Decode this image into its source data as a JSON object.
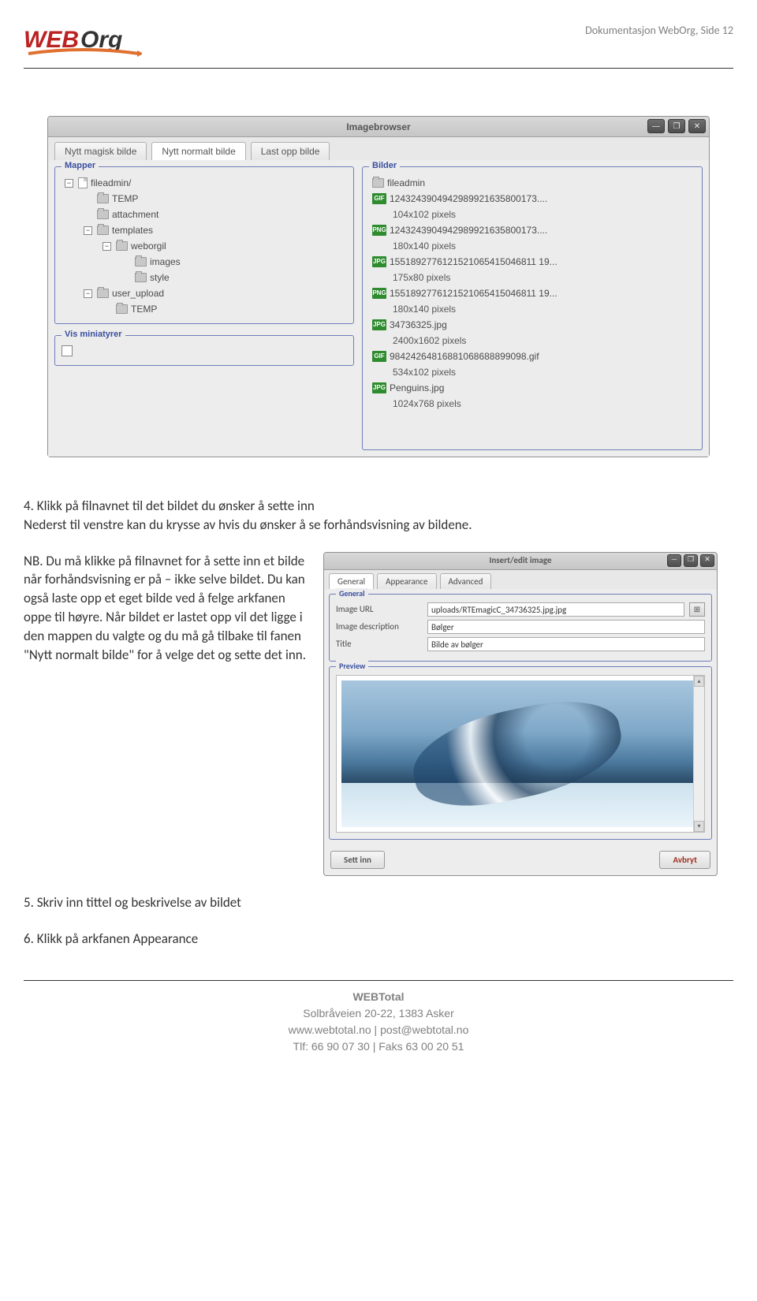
{
  "header": {
    "docline": "Dokumentasjon WebOrg, Side 12",
    "logo_text_a": "WEB",
    "logo_text_b": "Org"
  },
  "imagebrowser": {
    "title": "Imagebrowser",
    "tabs": [
      "Nytt magisk bilde",
      "Nytt normalt bilde",
      "Last opp bilde"
    ],
    "active_tab": 1,
    "folders_legend": "Mapper",
    "thumbs_legend": "Vis miniatyrer",
    "files_legend": "Bilder",
    "tree": [
      {
        "indent": 0,
        "pm": "−",
        "label": "fileadmin/",
        "icon": "file"
      },
      {
        "indent": 1,
        "pm": "",
        "label": "TEMP",
        "icon": "folder"
      },
      {
        "indent": 1,
        "pm": "",
        "label": "attachment",
        "icon": "folder"
      },
      {
        "indent": 1,
        "pm": "−",
        "label": "templates",
        "icon": "folder"
      },
      {
        "indent": 2,
        "pm": "−",
        "label": "weborgil",
        "icon": "folder"
      },
      {
        "indent": 3,
        "pm": "",
        "label": "images",
        "icon": "folder"
      },
      {
        "indent": 3,
        "pm": "",
        "label": "style",
        "icon": "folder"
      },
      {
        "indent": 1,
        "pm": "−",
        "label": "user_upload",
        "icon": "folder"
      },
      {
        "indent": 2,
        "pm": "",
        "label": "TEMP",
        "icon": "folder"
      }
    ],
    "files": [
      {
        "badge": "",
        "name": "fileadmin",
        "dims": ""
      },
      {
        "badge": "GIF",
        "name": "1243243904942989921635800173....",
        "dims": "104x102 pixels"
      },
      {
        "badge": "PNG",
        "name": "1243243904942989921635800173....",
        "dims": "180x140 pixels"
      },
      {
        "badge": "JPG",
        "name": "1551892776121521065415046811 19...",
        "dims": "175x80 pixels"
      },
      {
        "badge": "PNG",
        "name": "1551892776121521065415046811 19...",
        "dims": "180x140 pixels"
      },
      {
        "badge": "JPG",
        "name": "34736325.jpg",
        "dims": "2400x1602 pixels"
      },
      {
        "badge": "GIF",
        "name": "98424264816881068688899098.gif",
        "dims": "534x102 pixels"
      },
      {
        "badge": "JPG",
        "name": "Penguins.jpg",
        "dims": "1024x768 pixels"
      }
    ]
  },
  "body": {
    "step4_num": "4. ",
    "step4_line1": "Klikk på filnavnet til det bildet du ønsker å sette inn",
    "step4_line2": "Nederst til venstre kan du krysse av hvis du ønsker å se forhåndsvisning av bildene.",
    "nb": "NB. Du må klikke på filnavnet for å sette inn et bilde når forhåndsvisning er på – ikke selve bildet. Du kan også laste opp et eget bilde ved å felge arkfanen oppe til høyre. Når bildet er lastet opp vil det ligge i den mappen du valgte og du må gå tilbake til fanen \"Nytt normalt bilde\" for å velge det og sette det inn.",
    "step5": "5. Skriv inn tittel og beskrivelse av bildet",
    "step6": "6. Klikk på arkfanen Appearance"
  },
  "insert": {
    "title": "Insert/edit image",
    "tabs": [
      "General",
      "Appearance",
      "Advanced"
    ],
    "active_tab": 0,
    "general_legend": "General",
    "preview_legend": "Preview",
    "fields": {
      "url_label": "Image URL",
      "url_value": "uploads/RTEmagicC_34736325.jpg.jpg",
      "desc_label": "Image description",
      "desc_value": "Bølger",
      "title_label": "Title",
      "title_value": "Bilde av bølger"
    },
    "btn_ok": "Sett inn",
    "btn_cancel": "Avbryt"
  },
  "footer": {
    "name": "WEBTotal",
    "addr": "Solbråveien 20-22, 1383 Asker",
    "web": "www.webtotal.no | post@webtotal.no",
    "tel": "Tlf: 66 90 07 30 | Faks 63 00 20 51"
  }
}
